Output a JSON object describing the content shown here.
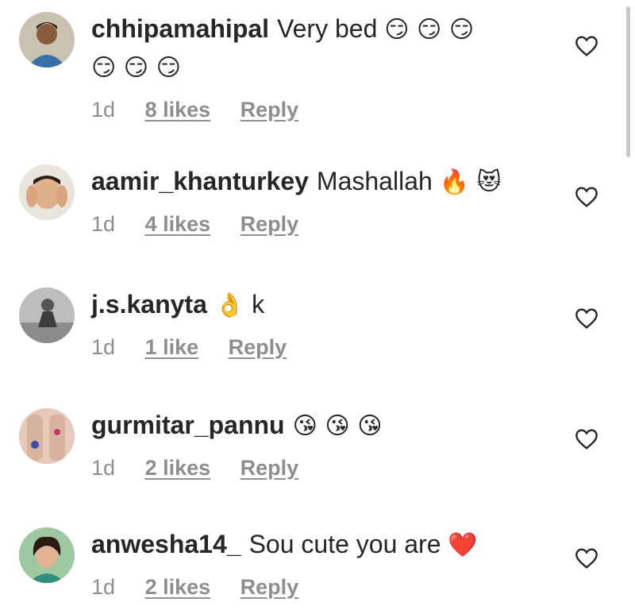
{
  "comments": [
    {
      "username": "chhipamahipal",
      "text": "Very bed",
      "emoji_line1": "😏 😏 😏",
      "emoji_line2": "😏 😏 😏",
      "time": "1d",
      "likes": "8 likes",
      "reply": "Reply"
    },
    {
      "username": "aamir_khanturkey",
      "text": "Mashallah",
      "emoji": "🔥 😻",
      "time": "1d",
      "likes": "4 likes",
      "reply": "Reply"
    },
    {
      "username": "j.s.kanyta",
      "emoji": "👌",
      "text": "k",
      "time": "1d",
      "likes": "1 like",
      "reply": "Reply"
    },
    {
      "username": "gurmitar_pannu",
      "emoji": "😘 😘 😘",
      "time": "1d",
      "likes": "2 likes",
      "reply": "Reply"
    },
    {
      "username": "anwesha14_",
      "text": "Sou cute you are",
      "emoji": "❤️",
      "time": "1d",
      "likes": "2 likes",
      "reply": "Reply"
    }
  ],
  "icons": {
    "like": "heart-outline-icon"
  },
  "colors": {
    "meta_text": "#8e8e8e",
    "primary_text": "#262626"
  }
}
